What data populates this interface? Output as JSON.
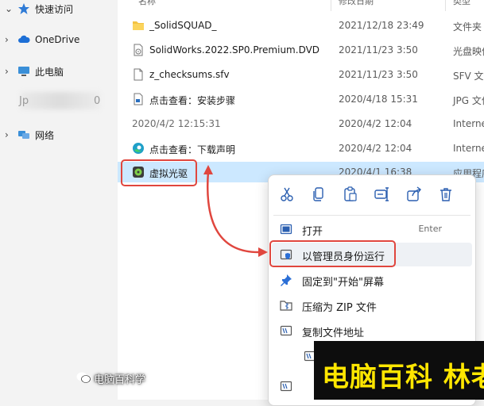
{
  "sidebar": {
    "items": [
      {
        "label": "快速访问",
        "icon": "star-icon"
      },
      {
        "label": "OneDrive",
        "icon": "cloud-icon"
      },
      {
        "label": "此电脑",
        "icon": "monitor-icon"
      },
      {
        "label": "网络",
        "icon": "network-icon"
      }
    ],
    "blurred_prefix": "Jp",
    "blurred_suffix": "0"
  },
  "header": {
    "name": "名称",
    "date": "修改日期",
    "type": "类型"
  },
  "files": [
    {
      "name": "_SolidSQUAD_",
      "date": "2021/12/18 23:49",
      "type": "文件夹",
      "icon": "folder-icon"
    },
    {
      "name": "SolidWorks.2022.SP0.Premium.DVD",
      "date": "2021/11/23 3:50",
      "type": "光盘映像",
      "icon": "disc-image-icon"
    },
    {
      "name": "z_checksums.sfv",
      "date": "2021/11/23 3:50",
      "type": "SFV 文件",
      "icon": "file-icon"
    },
    {
      "name": "点击查看：安装步骤",
      "date": "2020/4/18 15:31",
      "type": "JPG 文件",
      "icon": "image-file-icon"
    },
    {
      "name": "2020/4/2 12:15:31",
      "date": "2020/4/2 12:04",
      "type": "Internet",
      "icon": ""
    },
    {
      "name": "点击查看：下载声明",
      "date": "2020/4/2 12:04",
      "type": "Internet",
      "icon": "edge-icon"
    },
    {
      "name": "虚拟光驱",
      "date": "2020/4/1 16:38",
      "type": "应用程序",
      "icon": "app-icon"
    }
  ],
  "context_menu": {
    "toolbar": [
      "cut-icon",
      "copy-icon",
      "paste-icon",
      "rename-icon",
      "share-icon",
      "delete-icon"
    ],
    "items": [
      {
        "label": "打开",
        "shortcut": "Enter",
        "icon": "open-icon"
      },
      {
        "label": "以管理员身份运行",
        "shortcut": "",
        "icon": "shield-icon"
      },
      {
        "label": "固定到\"开始\"屏幕",
        "shortcut": "",
        "icon": "pin-icon"
      },
      {
        "label": "压缩为 ZIP 文件",
        "shortcut": "",
        "icon": "zip-icon"
      },
      {
        "label": "复制文件地址",
        "shortcut": "",
        "icon": "path-icon"
      }
    ]
  },
  "watermark": {
    "banner": "电脑百科 林老师",
    "source": "电脑百科学"
  },
  "colors": {
    "highlight": "#e0463e",
    "selection": "#cce8ff",
    "banner_text": "#ffe600"
  }
}
